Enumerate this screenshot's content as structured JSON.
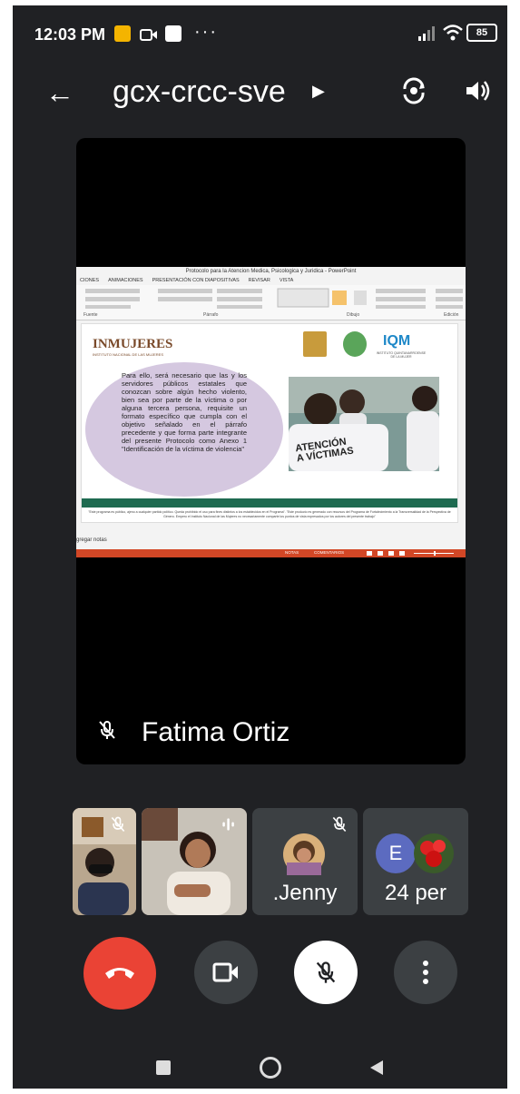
{
  "status_bar": {
    "time": "12:03 PM",
    "more_dots": "···",
    "battery_level": "85"
  },
  "app_bar": {
    "meeting_code": "gcx-crcc-sve"
  },
  "presentation": {
    "ppt_window_title": "Protocolo para la Atencion Medica, Psicologica y Juridica - PowerPoint",
    "ribbon_tabs": [
      "CIONES",
      "ANIMACIONES",
      "PRESENTACIÓN CON DIAPOSITIVAS",
      "REVISAR",
      "VISTA"
    ],
    "ribbon_groups": [
      "Fuente",
      "Párrafo",
      "Dibujo",
      "Edición"
    ],
    "org_logo": "INMUJERES",
    "org_logo_sub": "INSTITUTO NACIONAL DE LAS MUJERES",
    "iqm_logo": "IQM",
    "iqm_sub": "INSTITUTO QUINTANARROENSE DE LA MUJER",
    "bubble_text": "Para ello, será necesario que las y los servidores públicos estatales que conozcan sobre algún hecho violento, bien sea por parte de la víctima o por alguna tercera persona, requisite un formato específico que cumpla con el objetivo señalado en el párrafo precedente y que forma parte integrante del presente Protocolo como Anexo 1 \"Identificación de la víctima de violencia\"",
    "photo_caption_1": "ATENCIÓN",
    "photo_caption_2": "A VÍCTIMAS",
    "footer_note": "\"Este programa es público, ajeno a cualquier partido político. Queda prohibido el uso para fines distintos a los establecidos en el Programa\". \"Este producto es generado con recursos del Programa de Fortalecimiento a la Transversalidad de la Perspectiva de Género. Empero el Instituto Nacional de las Mujeres no necesariamente comparte los puntos de vista expresados por los autores del presente trabajo\"",
    "notes_label": "gregar notas",
    "status_notes": "NOTAS",
    "status_comments": "COMENTARIOS"
  },
  "main_speaker": {
    "name": "Fatima Ortiz"
  },
  "participants": [
    {
      "name": ""
    },
    {
      "name": ""
    },
    {
      "name": ".Jenny"
    },
    {
      "name": "24 per",
      "initial": "E"
    }
  ],
  "colors": {
    "background": "#202124",
    "end_call": "#ea4335",
    "tile": "#3c4043"
  }
}
